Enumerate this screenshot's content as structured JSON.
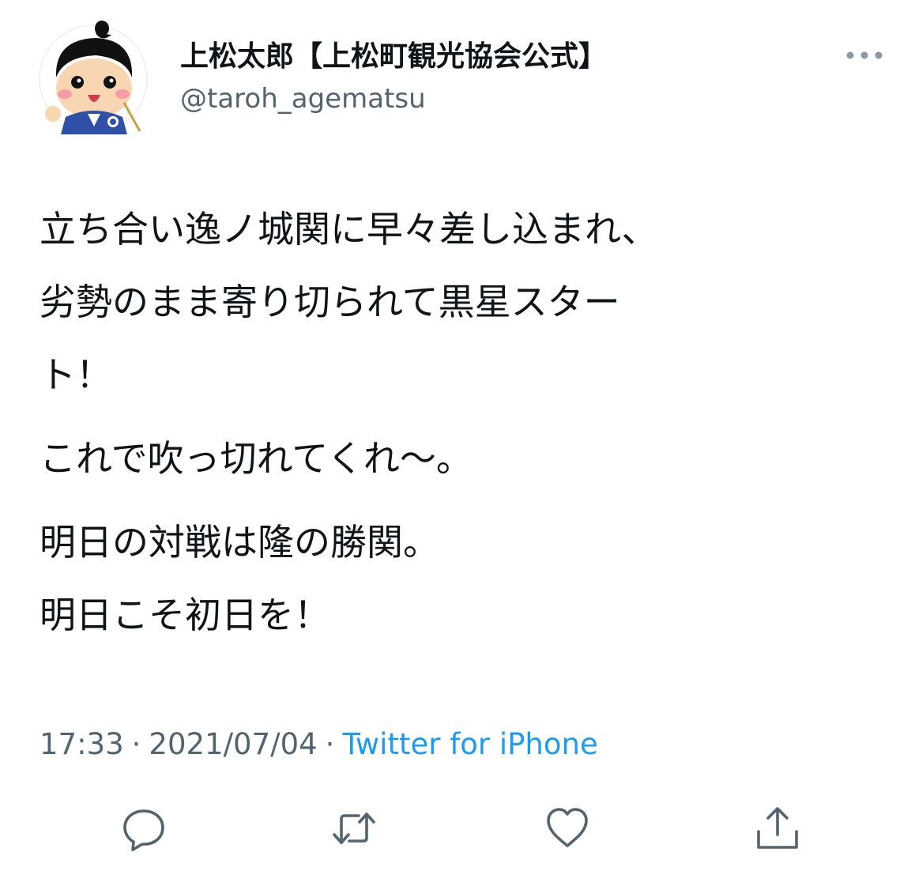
{
  "tweet": {
    "display_name": "上松太郎【上松町観光協会公式】",
    "handle": "@taroh_agematsu",
    "paragraphs": [
      "立ち合い逸ノ城関に早々差し込まれ、\n劣勢のまま寄り切られて黒星スター\nト！",
      "これで吹っ切れてくれ〜。",
      "明日の対戦は隆の勝関。\n明日こそ初日を！"
    ],
    "time": "17:33",
    "date": "2021/07/04",
    "separator": "·",
    "source": "Twitter for iPhone"
  },
  "icons": {
    "avatar": "mascot-avatar",
    "more": "more-dots-icon",
    "reply": "reply-icon",
    "retweet": "retweet-icon",
    "like": "like-icon",
    "share": "share-icon"
  },
  "colors": {
    "text": "#0f1419",
    "secondary": "#536471",
    "link": "#1d9bf0"
  }
}
